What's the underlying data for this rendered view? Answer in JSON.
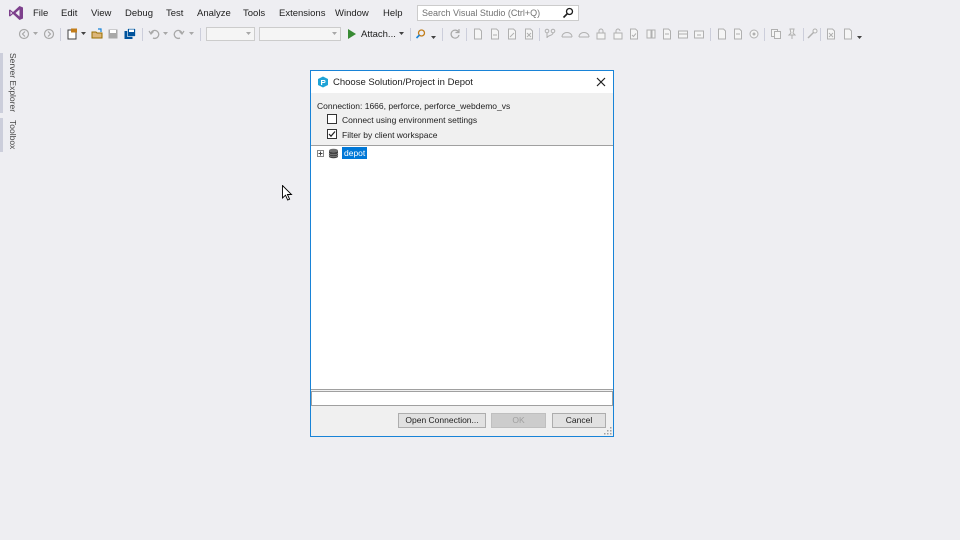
{
  "menubar": {
    "items": [
      "File",
      "Edit",
      "View",
      "Debug",
      "Test",
      "Analyze",
      "Tools",
      "Extensions",
      "Window",
      "Help"
    ],
    "search_placeholder": "Search Visual Studio (Ctrl+Q)"
  },
  "toolbar": {
    "attach_label": "Attach...",
    "icons": [
      "back-icon",
      "forward-icon",
      "new-project-icon",
      "open-file-icon",
      "save-icon",
      "save-all-icon",
      "undo-icon",
      "redo-icon",
      "start-icon",
      "find-icon",
      "refresh-icon",
      "document-icon",
      "source-control-icon"
    ]
  },
  "side_tabs": {
    "server_explorer": "Server Explorer",
    "toolbox": "Toolbox"
  },
  "dialog": {
    "title": "Choose Solution/Project in Depot",
    "connection": "Connection: 1666, perforce, perforce_webdemo_vs",
    "checkboxes": [
      {
        "label": "Connect using environment settings",
        "checked": false
      },
      {
        "label": "Filter by client workspace",
        "checked": true
      }
    ],
    "tree": {
      "items": [
        {
          "label": "depot",
          "selected": true,
          "expanded": false
        }
      ]
    },
    "path_value": "",
    "buttons": {
      "open_connection": "Open Connection...",
      "ok": "OK",
      "cancel": "Cancel"
    }
  },
  "colors": {
    "accent": "#1883d7",
    "selection": "#0078d7",
    "ide_background": "#eeeef2"
  }
}
